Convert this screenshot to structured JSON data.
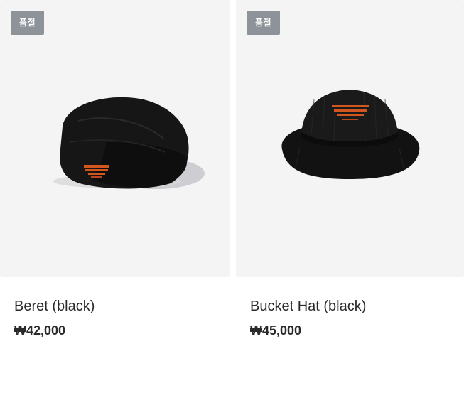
{
  "products": [
    {
      "badge": "품절",
      "name": "Beret (black)",
      "price": "₩42,000",
      "image_icon": "beret-icon"
    },
    {
      "badge": "품절",
      "name": "Bucket Hat (black)",
      "price": "₩45,000",
      "image_icon": "bucket-hat-icon"
    }
  ],
  "colors": {
    "card_bg": "#f4f4f4",
    "badge_bg": "#8d9398",
    "text": "#2a2a2a",
    "hat": "#151515",
    "logo": "#d4561f"
  }
}
